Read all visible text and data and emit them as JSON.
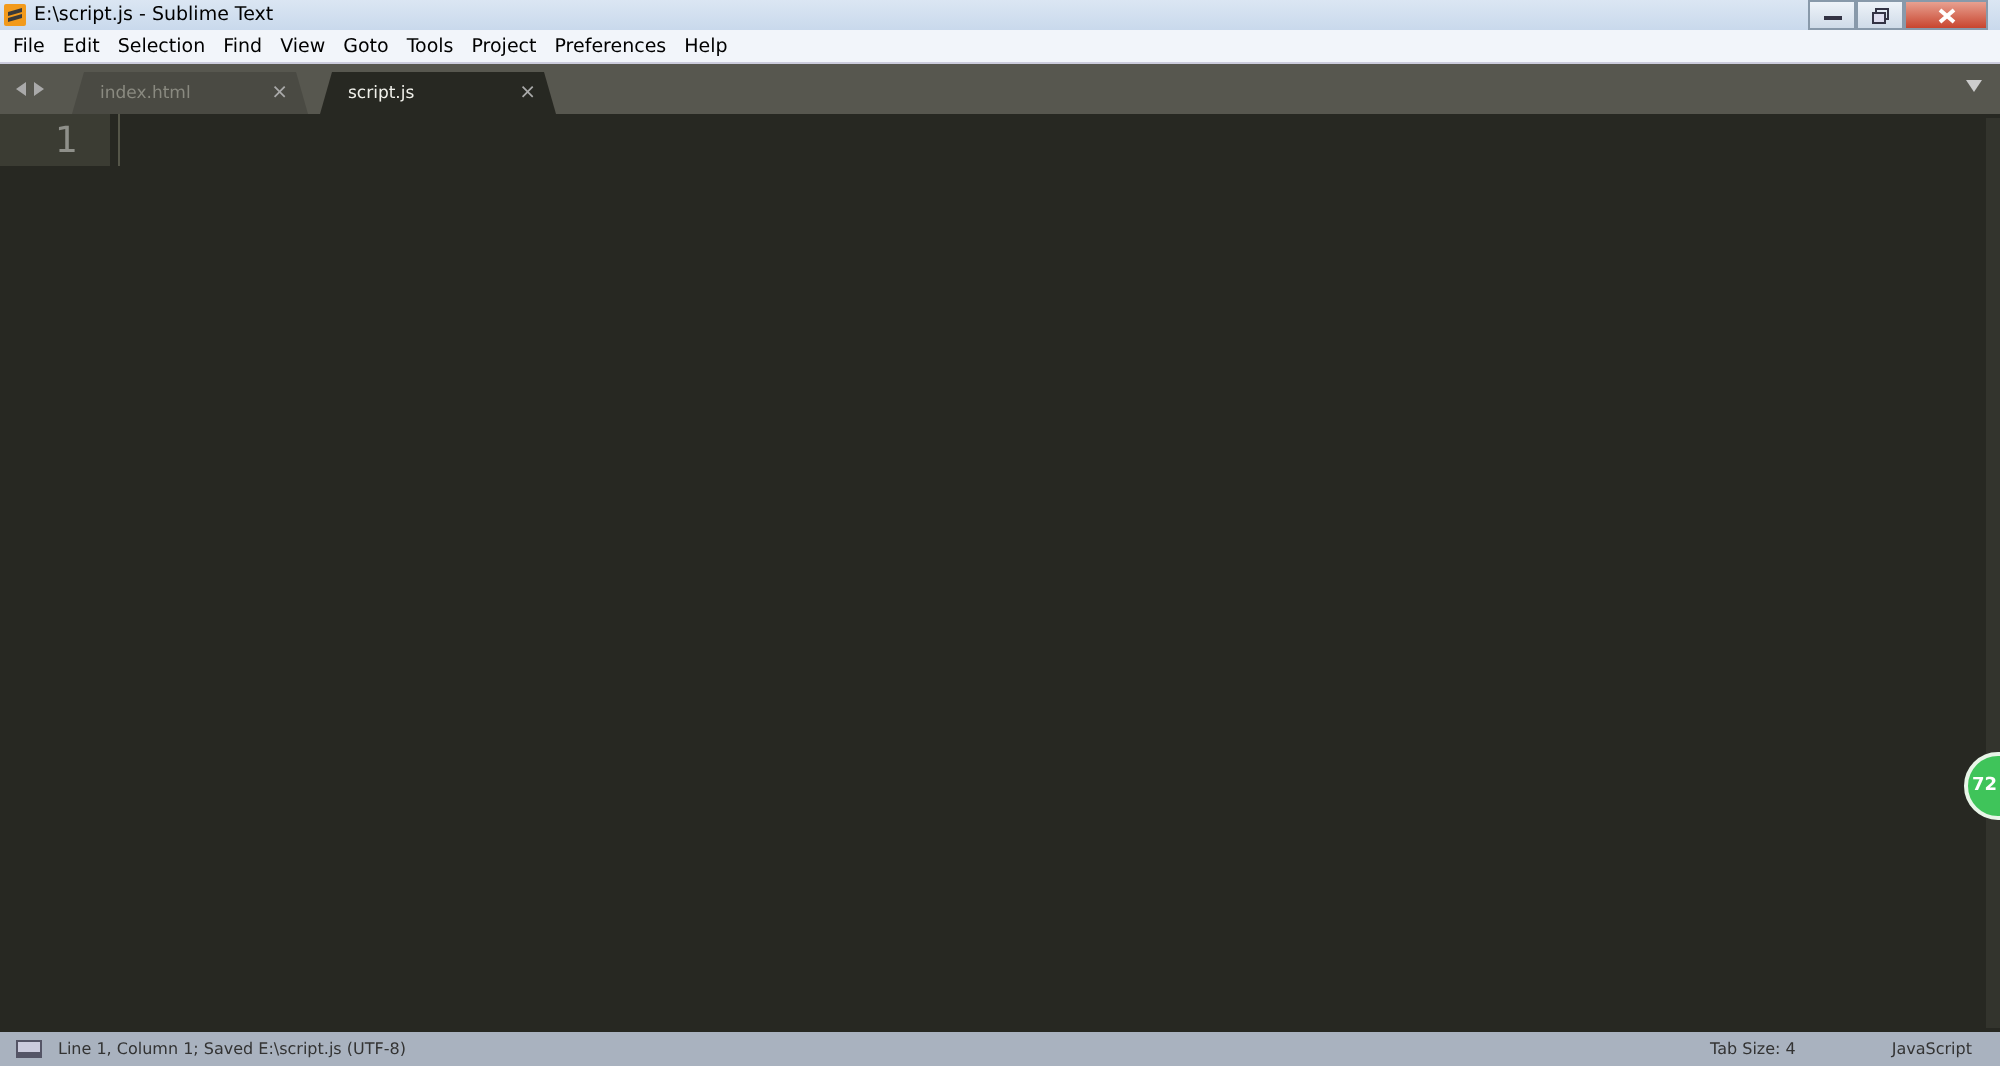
{
  "window": {
    "title": "E:\\script.js - Sublime Text"
  },
  "menu": [
    "File",
    "Edit",
    "Selection",
    "Find",
    "View",
    "Goto",
    "Tools",
    "Project",
    "Preferences",
    "Help"
  ],
  "tabs": [
    {
      "label": "index.html",
      "close": "×",
      "selected": false
    },
    {
      "label": "script.js",
      "close": "×",
      "selected": true
    }
  ],
  "editor": {
    "line_numbers": [
      "1"
    ]
  },
  "floating_badge": {
    "text": "72"
  },
  "status_bar": {
    "left": "Line 1, Column 1; Saved E:\\script.js (UTF-8)",
    "tab_size": "Tab Size: 4",
    "syntax": "JavaScript"
  }
}
